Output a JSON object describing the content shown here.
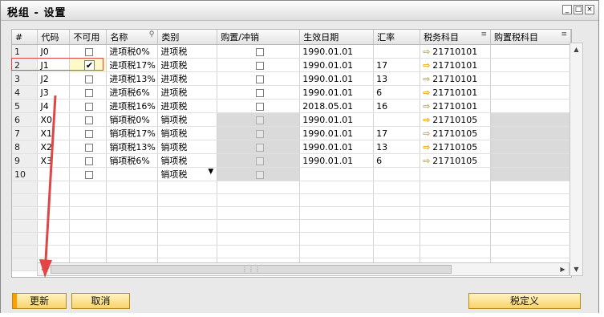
{
  "window": {
    "title": "税组 - 设置",
    "controls": [
      "_",
      "□",
      "×"
    ]
  },
  "grid": {
    "columns": [
      "#",
      "代码",
      "不可用",
      "名称",
      "类别",
      "购置/冲销",
      "生效日期",
      "汇率",
      "税务科目",
      "购置税科目"
    ],
    "rows": [
      {
        "num": "1",
        "code": "J0",
        "disabled": false,
        "name": "进项税0%",
        "category": "进项税",
        "purchase_disabled": false,
        "date": "1990.01.01",
        "rate": "",
        "account": "21710101"
      },
      {
        "num": "2",
        "code": "J1",
        "disabled": true,
        "name": "进项税17%",
        "category": "进项税",
        "purchase_disabled": false,
        "date": "1990.01.01",
        "rate": "17",
        "account": "21710101"
      },
      {
        "num": "3",
        "code": "J2",
        "disabled": false,
        "name": "进项税13%",
        "category": "进项税",
        "purchase_disabled": false,
        "date": "1990.01.01",
        "rate": "13",
        "account": "21710101"
      },
      {
        "num": "4",
        "code": "J3",
        "disabled": false,
        "name": "进项税6%",
        "category": "进项税",
        "purchase_disabled": false,
        "date": "1990.01.01",
        "rate": "6",
        "account": "21710101"
      },
      {
        "num": "5",
        "code": "J4",
        "disabled": false,
        "name": "进项税16%",
        "category": "进项税",
        "purchase_disabled": false,
        "date": "2018.05.01",
        "rate": "16",
        "account": "21710101"
      },
      {
        "num": "6",
        "code": "X0",
        "disabled": false,
        "name": "销项税0%",
        "category": "销项税",
        "purchase_disabled": true,
        "date": "1990.01.01",
        "rate": "",
        "account": "21710105"
      },
      {
        "num": "7",
        "code": "X1",
        "disabled": false,
        "name": "销项税17%",
        "category": "销项税",
        "purchase_disabled": true,
        "date": "1990.01.01",
        "rate": "17",
        "account": "21710105"
      },
      {
        "num": "8",
        "code": "X2",
        "disabled": false,
        "name": "销项税13%",
        "category": "销项税",
        "purchase_disabled": true,
        "date": "1990.01.01",
        "rate": "13",
        "account": "21710105"
      },
      {
        "num": "9",
        "code": "X3",
        "disabled": false,
        "name": "销项税6%",
        "category": "销项税",
        "purchase_disabled": true,
        "date": "1990.01.01",
        "rate": "6",
        "account": "21710105"
      },
      {
        "num": "10",
        "code": "",
        "disabled": false,
        "name": "",
        "category": "销项税",
        "purchase_disabled": true,
        "date": "",
        "rate": "",
        "account": ""
      }
    ],
    "empty_rows": 7
  },
  "buttons": {
    "update": "更新",
    "cancel": "取消",
    "tax_definition": "税定义"
  },
  "colors": {
    "button_fill": "#f8d36c",
    "disabled_cell": "#dadada",
    "highlight_red": "#e24545",
    "link_arrow": "#e2a200"
  },
  "icons": {
    "link_arrow": "golden-arrow-icon",
    "column_menu": "list-icon",
    "search": "key-icon"
  }
}
